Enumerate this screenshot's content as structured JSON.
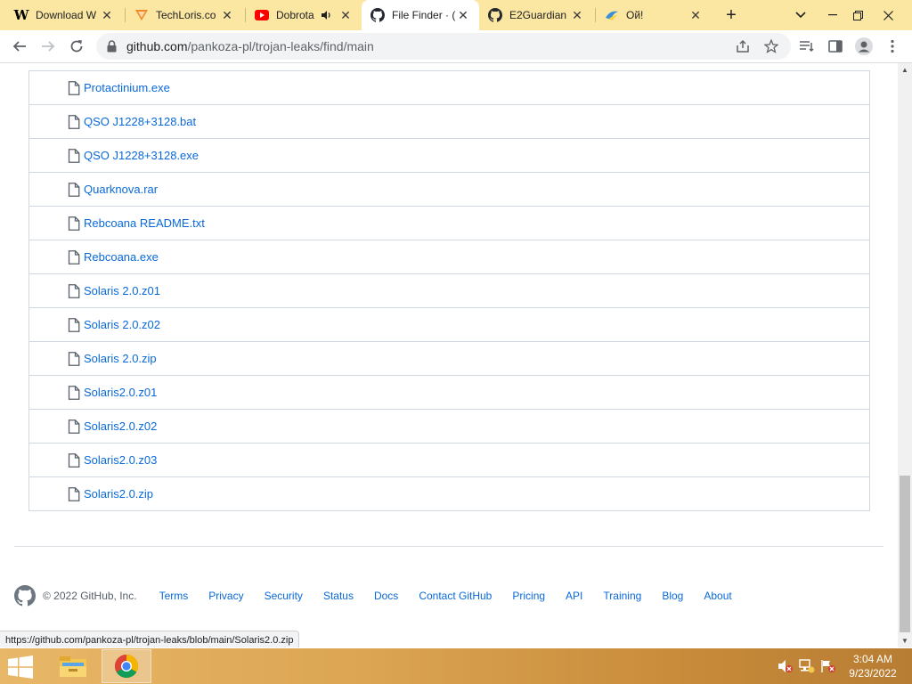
{
  "browser": {
    "tabs": [
      {
        "title": "Download W",
        "favicon": "wikipedia-w-icon"
      },
      {
        "title": "TechLoris.co",
        "favicon": "techloris-icon"
      },
      {
        "title": "Dobrota",
        "favicon": "youtube-icon",
        "audio": true
      },
      {
        "title": "File Finder · (",
        "favicon": "github-icon",
        "active": true
      },
      {
        "title": "E2Guardian",
        "favicon": "github-icon"
      },
      {
        "title": "Ой!",
        "favicon": "ukr-wave-icon"
      }
    ],
    "new_tab_label": "+",
    "url": {
      "host": "github.com",
      "path": "/pankoza-pl/trojan-leaks/find/main"
    }
  },
  "file_list": [
    "Protactinium.exe",
    "QSO J1228+3128.bat",
    "QSO J1228+3128.exe",
    "Quarknova.rar",
    "Rebcoana README.txt",
    "Rebcoana.exe",
    "Solaris 2.0.z01",
    "Solaris 2.0.z02",
    "Solaris 2.0.zip",
    "Solaris2.0.z01",
    "Solaris2.0.z02",
    "Solaris2.0.z03",
    "Solaris2.0.zip"
  ],
  "footer": {
    "copyright": "© 2022 GitHub, Inc.",
    "links": [
      "Terms",
      "Privacy",
      "Security",
      "Status",
      "Docs",
      "Contact GitHub",
      "Pricing",
      "API",
      "Training",
      "Blog",
      "About"
    ]
  },
  "status_url": "https://github.com/pankoza-pl/trojan-leaks/blob/main/Solaris2.0.zip",
  "taskbar": {
    "time": "3:04 AM",
    "date": "9/23/2022"
  },
  "colors": {
    "link": "#0969da",
    "tabbar": "#fbe6a2",
    "taskbar": "#dba553"
  }
}
